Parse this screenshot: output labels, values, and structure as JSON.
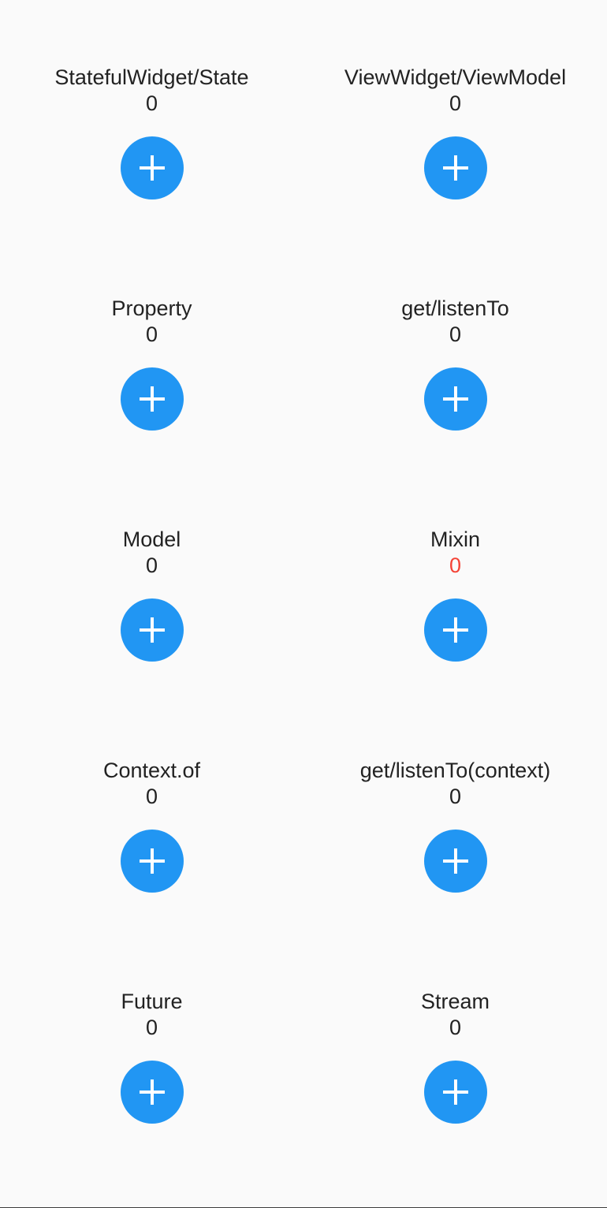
{
  "counters": [
    {
      "label": "StatefulWidget/State",
      "count": "0"
    },
    {
      "label": "ViewWidget/ViewModel",
      "count": "0"
    },
    {
      "label": "Property",
      "count": "0"
    },
    {
      "label": "get/listenTo",
      "count": "0"
    },
    {
      "label": "Model",
      "count": "0"
    },
    {
      "label": "Mixin",
      "count": "0",
      "count_color": "#f44336"
    },
    {
      "label": "Context.of",
      "count": "0"
    },
    {
      "label": "get/listenTo(context)",
      "count": "0"
    },
    {
      "label": "Future",
      "count": "0"
    },
    {
      "label": "Stream",
      "count": "0"
    }
  ],
  "fab": {
    "icon": "plus-icon",
    "color": "#2196f3"
  },
  "colors": {
    "background": "#fafafa",
    "text": "#222222",
    "accent": "#2196f3",
    "warning": "#f44336"
  }
}
